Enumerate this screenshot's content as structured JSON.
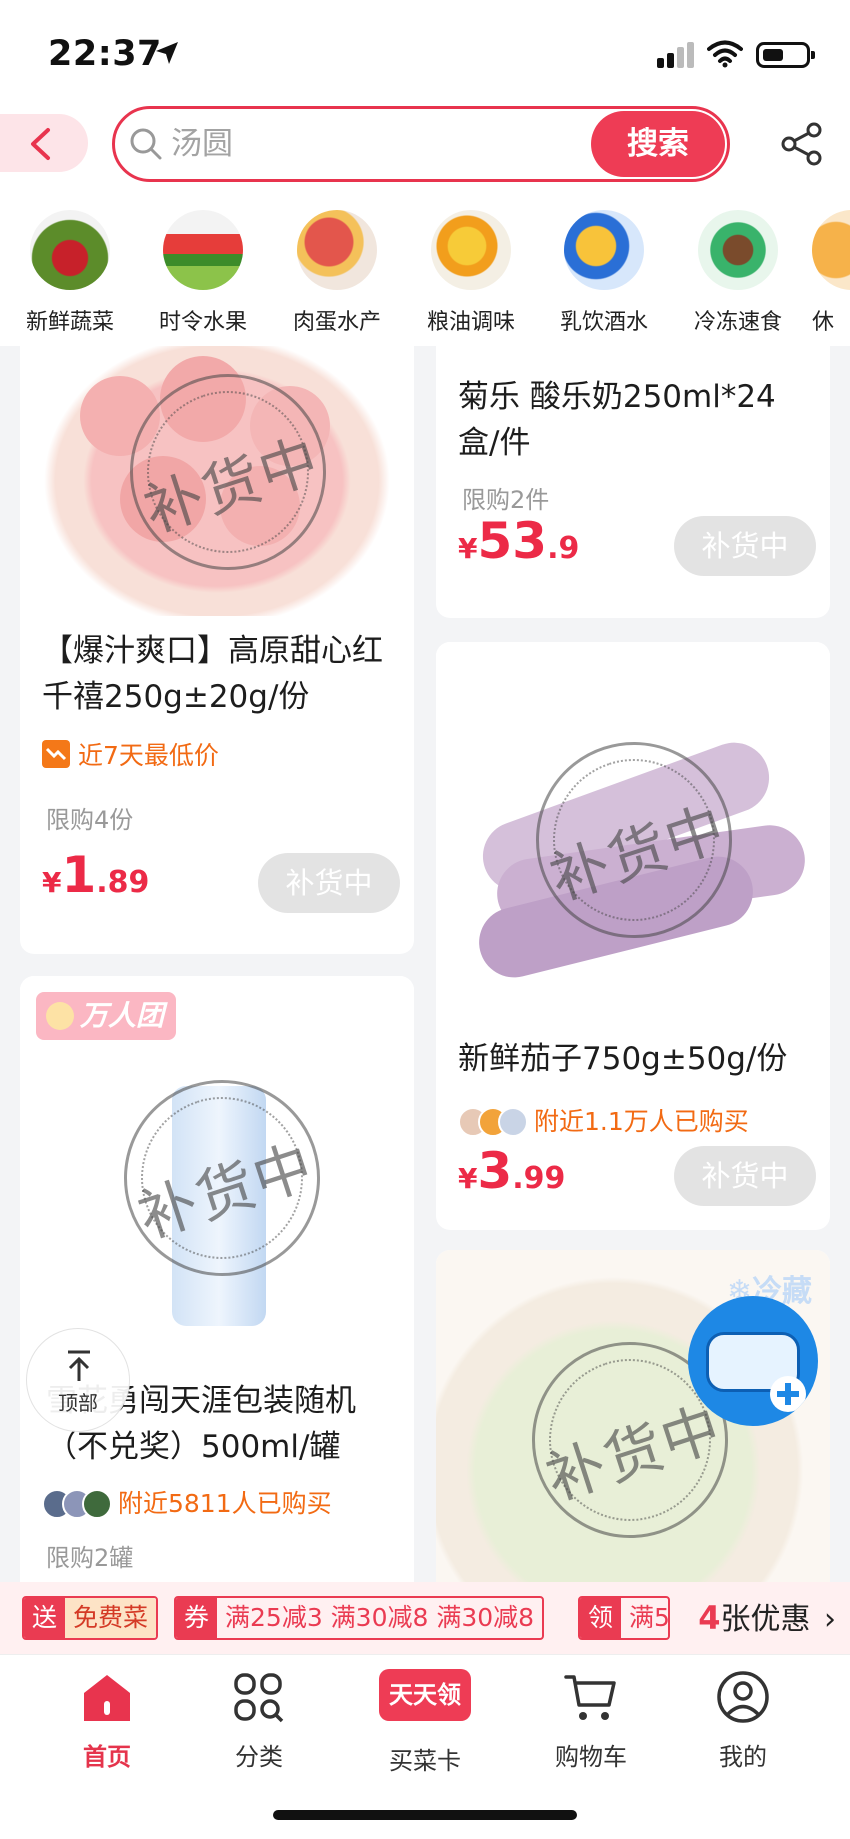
{
  "status_bar": {
    "time": "22:37"
  },
  "search": {
    "placeholder": "汤圆",
    "button_label": "搜索"
  },
  "categories": [
    {
      "label": "新鲜蔬菜",
      "icon": "vegetables-icon"
    },
    {
      "label": "时令水果",
      "icon": "watermelon-icon"
    },
    {
      "label": "肉蛋水产",
      "icon": "meat-egg-icon"
    },
    {
      "label": "粮油调味",
      "icon": "oil-grain-icon"
    },
    {
      "label": "乳饮酒水",
      "icon": "drinks-icon"
    },
    {
      "label": "冷冻速食",
      "icon": "frozen-food-icon"
    },
    {
      "label": "休",
      "icon": "snack-icon"
    }
  ],
  "products": [
    {
      "title": "【爆汁爽口】高原甜心红千禧250g±20g/份",
      "lowest_tag": "近7天最低价",
      "limit": "限购4份",
      "price_symbol": "¥",
      "price_int": "1",
      "price_dec": ".89",
      "stamp": "补货中",
      "action": "补货中"
    },
    {
      "title": "菊乐 酸乐奶250ml*24盒/件",
      "limit": "限购2件",
      "price_symbol": "¥",
      "price_int": "53",
      "price_dec": ".9",
      "action": "补货中"
    },
    {
      "title": "新鲜茄子750g±50g/份",
      "buyers": "附近1.1万人已购买",
      "price_symbol": "¥",
      "price_int": "3",
      "price_dec": ".99",
      "stamp": "补货中",
      "action": "补货中"
    },
    {
      "badge": "万人团",
      "title": "雪花勇闯天涯包装随机（不兑奖）500ml/罐",
      "buyers": "附近5811人已购买",
      "limit": "限购2罐",
      "stamp": "补货中"
    },
    {
      "badge": "冷藏",
      "stamp": "补货中"
    }
  ],
  "floating": {
    "back_to_top": "顶部"
  },
  "coupon_strip": {
    "gift_tag": "送",
    "gift_text": "免费菜",
    "coupon_tag": "券",
    "coupon_text": "满25减3  满30减8  满30减8",
    "claim_tag": "领",
    "claim_text": "满5",
    "total_count": "4",
    "total_text": "张优惠"
  },
  "tabbar": [
    {
      "label": "首页",
      "active": true
    },
    {
      "label": "分类"
    },
    {
      "label": "买菜卡",
      "badge": "天天领"
    },
    {
      "label": "购物车"
    },
    {
      "label": "我的"
    }
  ],
  "colors": {
    "brand_red": "#e8344e",
    "price_red": "#ec2a47",
    "orange": "#f26a13"
  }
}
